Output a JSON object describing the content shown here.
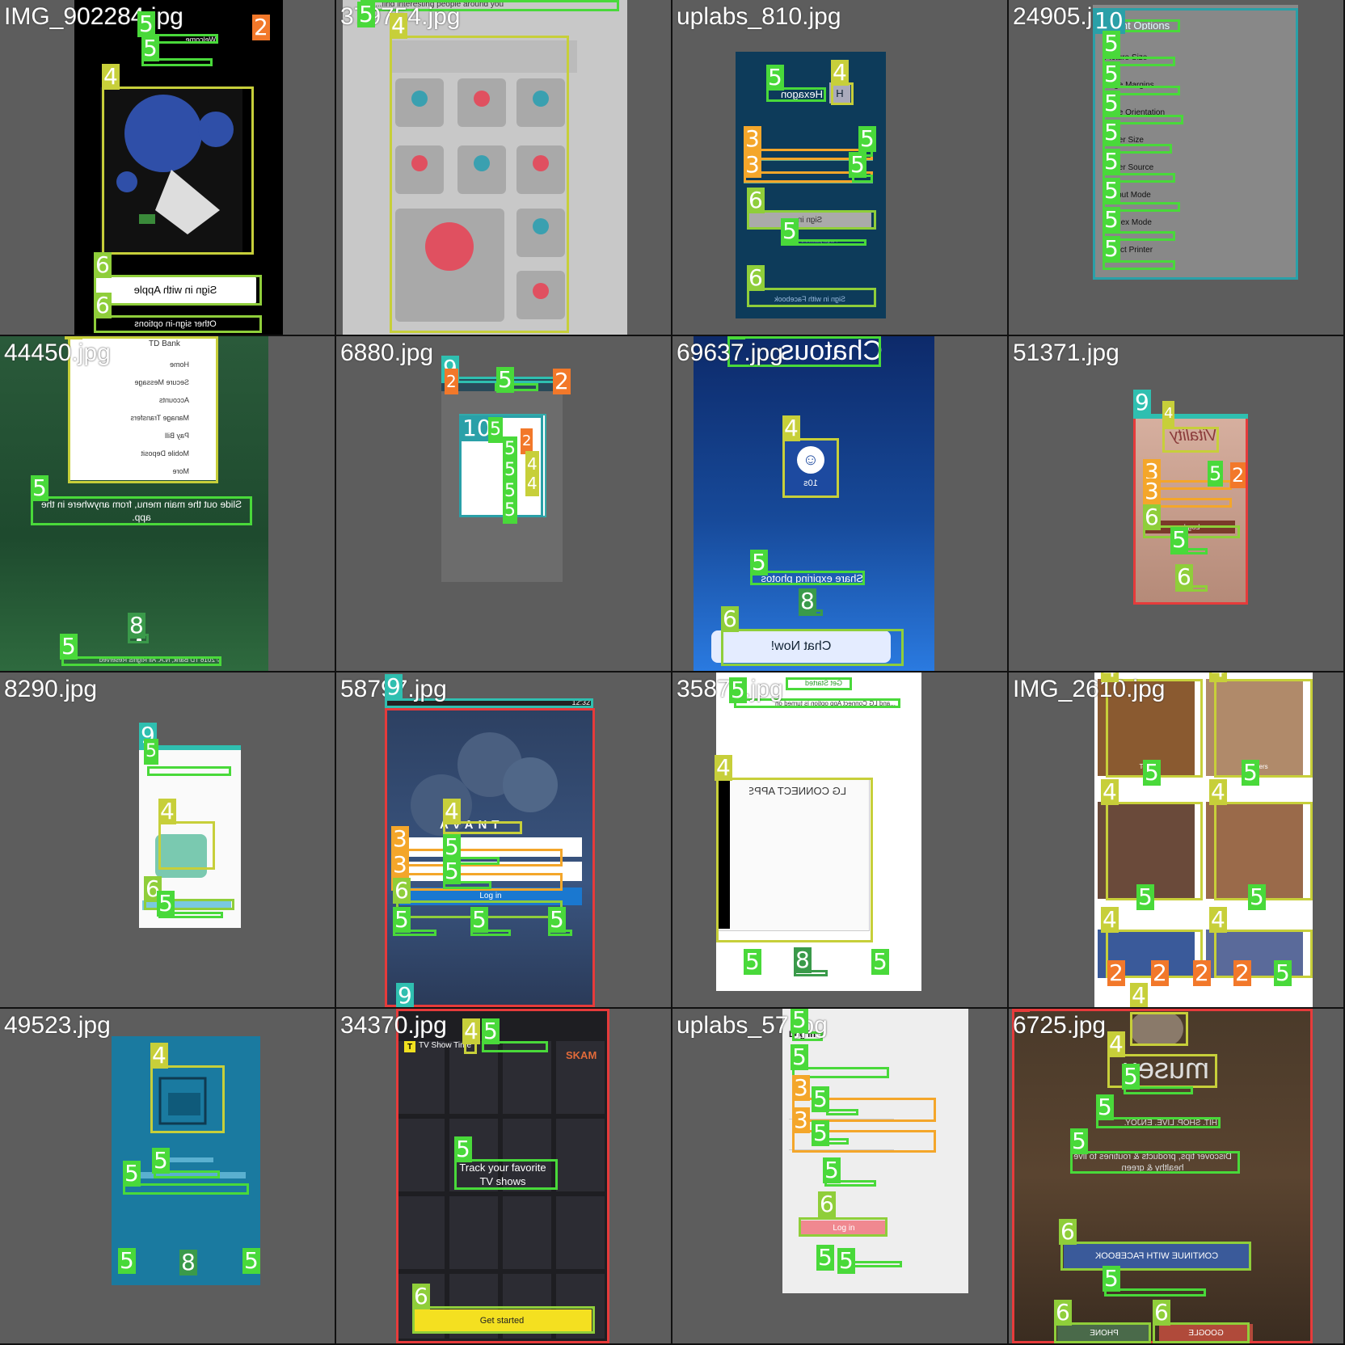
{
  "tiles": [
    {
      "file": "IMG_902284.jpg",
      "texts": {
        "welcome": "Welcome",
        "apple": "Sign in with Apple",
        "other": "Other sign-in options"
      }
    },
    {
      "file": "379754.jpg",
      "texts": {
        "top": "...find interesting people around you"
      }
    },
    {
      "file": "uplabs_810.jpg",
      "texts": {
        "logo": "Hexagon",
        "h": "H",
        "signin": "Sign in",
        "forgot": "Forgot password?",
        "fb": "Sign in with Facebook"
      }
    },
    {
      "file": "24905.jpg",
      "texts": {
        "title": "Print Options",
        "items": [
          "Picture Size",
          "Page Margins",
          "Page Orientation",
          "Paper Size",
          "Paper Source",
          "Output Mode",
          "Duplex Mode",
          "Select Printer"
        ]
      }
    },
    {
      "file": "44450.jpg",
      "texts": {
        "bank": "TD Bank",
        "menu": [
          "Home",
          "Secure Message",
          "Accounts",
          "Manage Transfers",
          "Pay Bill",
          "Mobile Deposit",
          "More"
        ],
        "slide": "Slide out the main menu, from anywhere in the app.",
        "copy": "© 2016 TD Bank, N.A. All Rights Reserved"
      }
    },
    {
      "file": "6880.jpg",
      "texts": {}
    },
    {
      "file": "69637.jpg",
      "texts": {
        "logo": "Chatous",
        "time": "10s",
        "share": "Share expiring photos",
        "chat": "Chat Now!"
      }
    },
    {
      "file": "51371.jpg",
      "texts": {
        "logo": "Vitality",
        "login": "Log In"
      }
    },
    {
      "file": "8290.jpg",
      "texts": {}
    },
    {
      "file": "58797.jpg",
      "texts": {
        "time": "12:32",
        "logo": "AVANT",
        "login": "Log in"
      }
    },
    {
      "file": "35875.jpg",
      "texts": {
        "top": "Get Started",
        "desc": "...and LG Connect App option is turned on",
        "apps": "LG CONNECT APPS"
      }
    },
    {
      "file": "IMG_2610.jpg",
      "texts": {
        "labels": [
          "Tops",
          "Sweaters",
          "Bras",
          "Kids"
        ]
      }
    },
    {
      "file": "49523.jpg",
      "texts": {}
    },
    {
      "file": "34370.jpg",
      "texts": {
        "brand": "TV Show Time",
        "track": "Track your favorite TV shows",
        "start": "Get started",
        "skam": "SKAM"
      }
    },
    {
      "file": "uplabs_57.jpg",
      "texts": {
        "title": "Log in",
        "login": "Log in"
      }
    },
    {
      "file": "6725.jpg",
      "texts": {
        "logo": "museu",
        "line1": "HIT. SHOP. LIVE. ENJOY.",
        "disc": "Discover tips, products & routines to live healthy & green",
        "fb": "CONTINUE WITH FACEBOOK",
        "google": "GOOGLE",
        "phone": "PHONE"
      }
    }
  ]
}
